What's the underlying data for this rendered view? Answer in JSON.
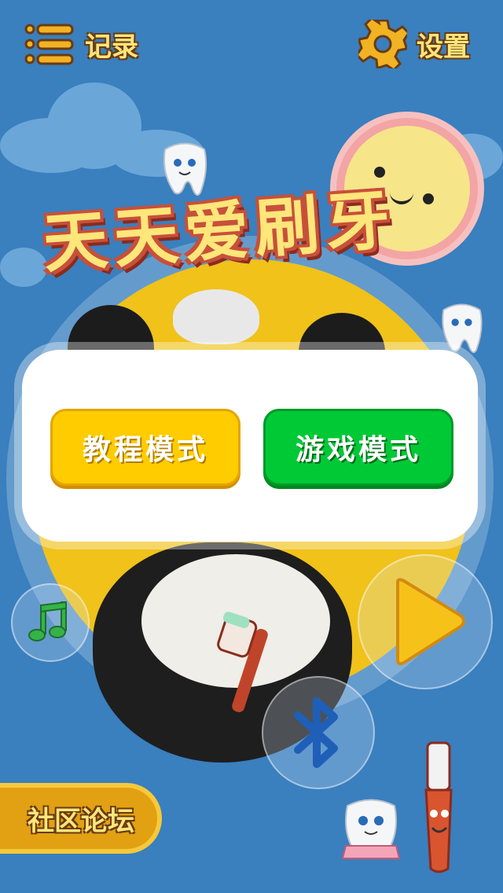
{
  "app_title": "天天爱刷牙",
  "topbar": {
    "records_label": "记录",
    "settings_label": "设置"
  },
  "mode_dialog": {
    "tutorial_label": "教程模式",
    "game_label": "游戏模式"
  },
  "bottom": {
    "forum_label": "社区论坛"
  },
  "icons": {
    "records": "list-icon",
    "settings": "gear-icon",
    "music": "music-note-icon",
    "play": "play-icon",
    "bluetooth": "bluetooth-icon"
  },
  "colors": {
    "background": "#3a7fbe",
    "tutorial_button": "#ffcc00",
    "game_button": "#00c936",
    "label_yellow": "#fde67a"
  }
}
